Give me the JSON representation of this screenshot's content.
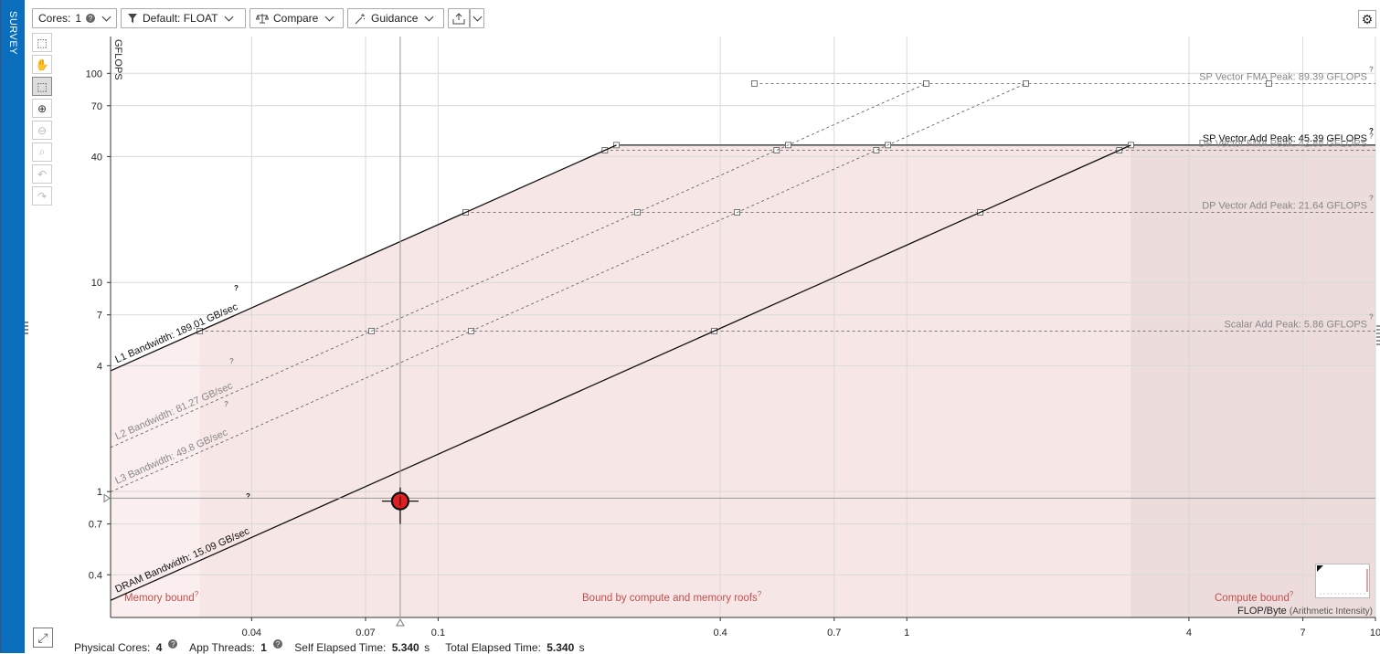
{
  "app": {
    "side_tab": "SURVEY"
  },
  "toolbar": {
    "cores_label": "Cores:",
    "cores_value": "1",
    "filter_label": "Default: FLOAT",
    "compare_label": "Compare",
    "guidance_label": "Guidance"
  },
  "footer": {
    "physical_cores_label": "Physical Cores:",
    "physical_cores_value": "4",
    "app_threads_label": "App Threads:",
    "app_threads_value": "1",
    "self_elapsed_label": "Self Elapsed Time:",
    "self_elapsed_value": "5.340",
    "total_elapsed_label": "Total Elapsed Time:",
    "total_elapsed_value": "5.340",
    "unit": "s"
  },
  "colors": {
    "accent": "#0a6ebd",
    "bound_fill": "#f7e6e6",
    "compute_fill": "#ecdcdc",
    "region_text": "#c0504d",
    "point_fill": "#e02020"
  },
  "chart_data": {
    "type": "scatter",
    "subtype": "roofline",
    "ylabel": "GFLOPS",
    "xlabel": "FLOP/Byte",
    "xlabel_note": "(Arithmetic Intensity)",
    "x_scale": "log",
    "y_scale": "log",
    "xlim": [
      0.02,
      10
    ],
    "ylim": [
      0.25,
      150
    ],
    "x_ticks": [
      0.04,
      0.07,
      0.1,
      0.4,
      0.7,
      1,
      4,
      7,
      10
    ],
    "x_tick_labels": [
      "0.04",
      "0.07",
      "0.1",
      "0.4",
      "0.7",
      "1",
      "4",
      "7",
      "10"
    ],
    "y_ticks": [
      0.4,
      0.7,
      1,
      4,
      7,
      10,
      40,
      70,
      100
    ],
    "y_tick_labels": [
      "0.4",
      "0.7",
      "1",
      "4",
      "7",
      "10",
      "40",
      "70",
      "100"
    ],
    "grid": true,
    "bandwidth_roofs": [
      {
        "label": "L1 Bandwidth: 189.01 GB/sec",
        "gbps": 189.01,
        "style": "solid"
      },
      {
        "label": "L2 Bandwidth: 81.27 GB/sec",
        "gbps": 81.27,
        "style": "dashed"
      },
      {
        "label": "L3 Bandwidth: 49.8 GB/sec",
        "gbps": 49.8,
        "style": "dashed"
      },
      {
        "label": "DRAM Bandwidth: 15.09 GB/sec",
        "gbps": 15.09,
        "style": "solid"
      }
    ],
    "compute_roofs": [
      {
        "label": "SP Vector FMA Peak: 89.39 GFLOPS",
        "gflops": 89.39,
        "style": "dashed"
      },
      {
        "label": "SP Vector Add Peak: 45.39 GFLOPS",
        "gflops": 45.39,
        "style": "solid"
      },
      {
        "label": "DP Vector FMA Peak: 42.88 GFLOPS",
        "gflops": 42.88,
        "style": "dashed"
      },
      {
        "label": "DP Vector Add Peak: 21.64 GFLOPS",
        "gflops": 21.64,
        "style": "dashed"
      },
      {
        "label": "Scalar Add Peak: 5.86 GFLOPS",
        "gflops": 5.86,
        "style": "dashed"
      }
    ],
    "points": [
      {
        "x": 0.083,
        "y": 0.9
      }
    ],
    "crosshair": {
      "x": 0.083,
      "y": 0.93
    },
    "regions": [
      {
        "label": "Memory bound",
        "x_to": 0.031
      },
      {
        "label": "Bound by compute and memory roofs",
        "x_to": 3.0
      },
      {
        "label": "Compute bound",
        "x_to": 10
      }
    ]
  }
}
